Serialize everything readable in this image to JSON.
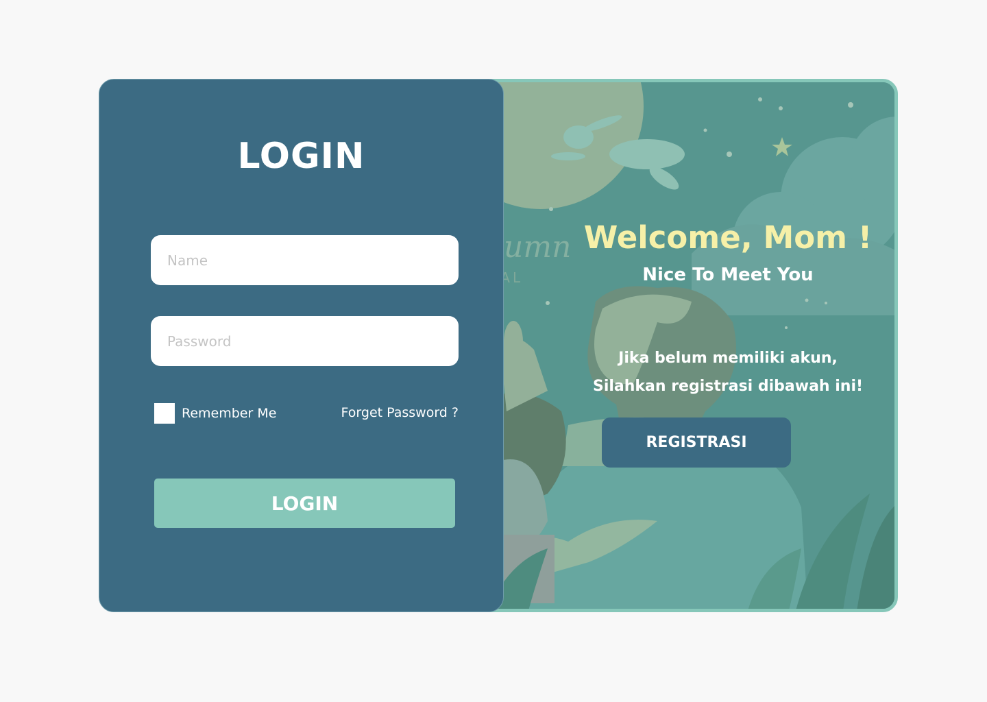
{
  "login": {
    "title": "LOGIN",
    "name_placeholder": "Name",
    "password_placeholder": "Password",
    "remember_label": "Remember Me",
    "forget_label": "Forget Password ?",
    "button_label": "LOGIN"
  },
  "hero": {
    "welcome": "Welcome, Mom !",
    "subtitle": "Nice To Meet You",
    "info_line1": "Jika belum memiliki akun,",
    "info_line2": "Silahkan registrasi dibawah ini!",
    "register_label": "REGISTRASI",
    "bg_text_1": "utumn",
    "bg_text_2": "IVAL"
  },
  "colors": {
    "panel": "#3c6b83",
    "accent": "#86c7b9",
    "welcome": "#f6f0a8",
    "page_bg": "#f8f8f8"
  }
}
